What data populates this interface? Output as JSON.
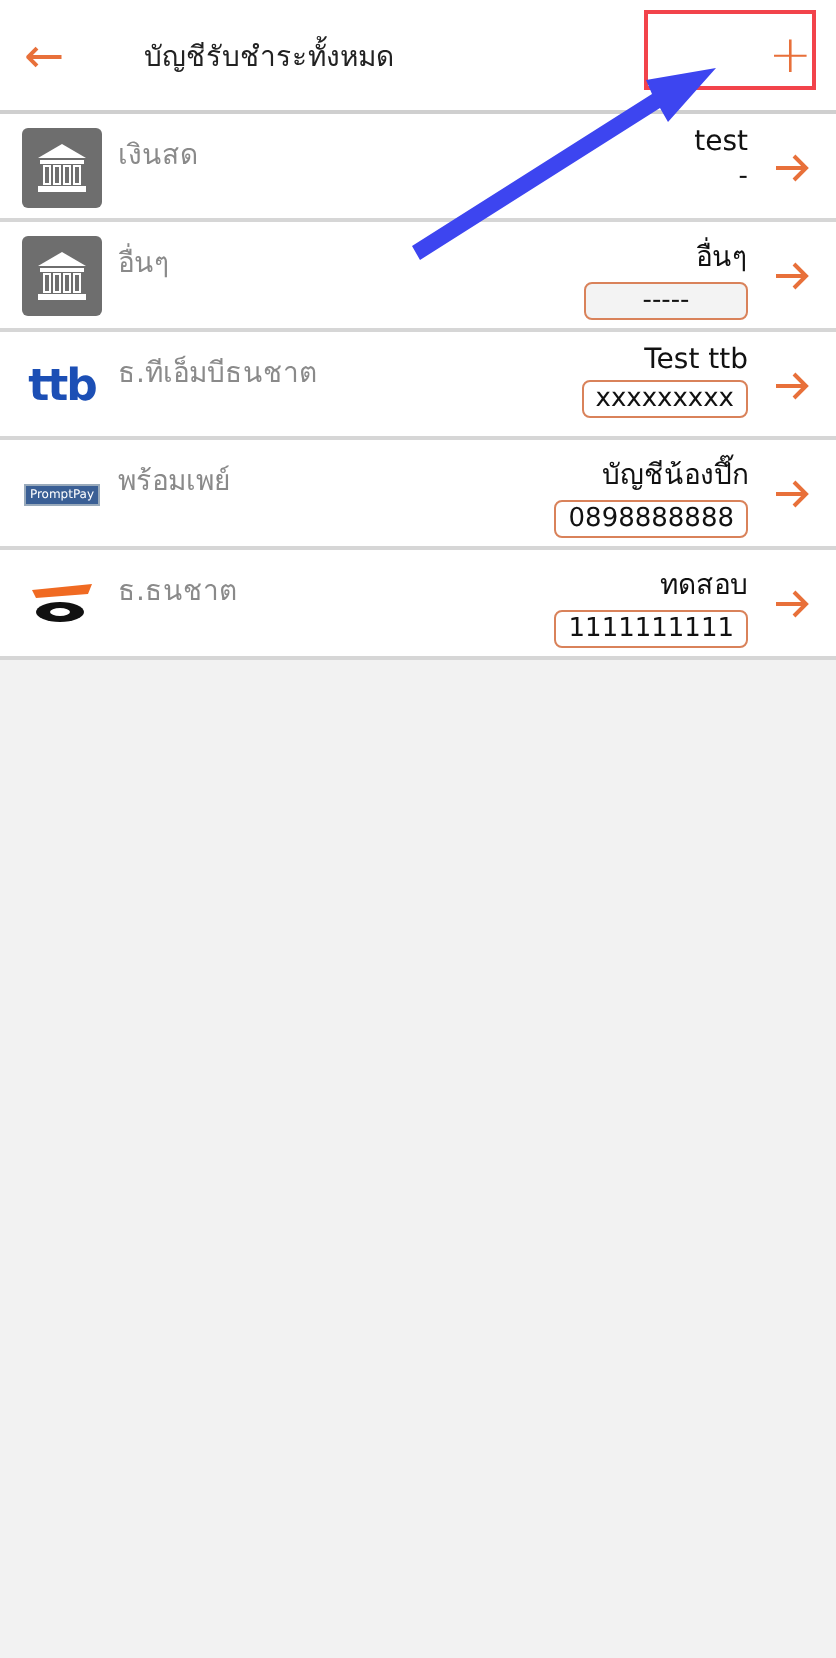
{
  "header": {
    "back_icon": "←",
    "title": "บัญชีรับชำระทั้งหมด",
    "add_icon": "+"
  },
  "accounts": [
    {
      "logo": {
        "kind": "bank"
      },
      "type": "เงินสด",
      "name": "test",
      "number": "-",
      "boxed": false,
      "disabled": false
    },
    {
      "logo": {
        "kind": "bank"
      },
      "type": "อื่นๆ",
      "name": "อื่นๆ",
      "number": "-----",
      "boxed": true,
      "disabled": true
    },
    {
      "logo": {
        "kind": "ttb",
        "text": "ttb"
      },
      "type": "ธ.ทีเอ็มบีธนชาต",
      "name": "Test ttb",
      "number": "xxxxxxxxx",
      "boxed": true,
      "disabled": false
    },
    {
      "logo": {
        "kind": "promptpay",
        "text": "PromptPay"
      },
      "type": "พร้อมเพย์",
      "name": "บัญชีน้องปึ๊ก",
      "number": "0898888888",
      "boxed": true,
      "disabled": false
    },
    {
      "logo": {
        "kind": "thanachart"
      },
      "type": "ธ.ธนชาต",
      "name": "ทดสอบ",
      "number": "1111111111",
      "boxed": true,
      "disabled": false
    }
  ],
  "annotation": {
    "highlight": true,
    "pointer": true
  }
}
